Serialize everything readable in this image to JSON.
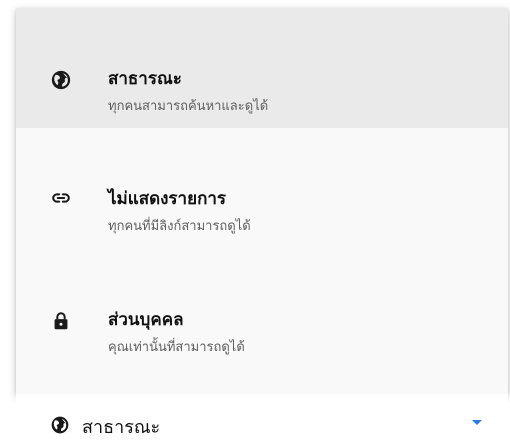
{
  "menu": {
    "items": [
      {
        "icon": "globe-icon",
        "title": "สาธารณะ",
        "subtitle": "ทุกคนสามารถค้นหาและดูได้",
        "selected": true
      },
      {
        "icon": "link-icon",
        "title": "ไม่แสดงรายการ",
        "subtitle": "ทุกคนที่มีลิงก์สามารถดูได้",
        "selected": false
      },
      {
        "icon": "lock-icon",
        "title": "ส่วนบุคคล",
        "subtitle": "คุณเท่านั้นที่สามารถดูได้",
        "selected": false
      }
    ]
  },
  "select": {
    "icon": "globe-icon",
    "value": "สาธารณะ",
    "arrow_color": "#2a7ae2"
  }
}
